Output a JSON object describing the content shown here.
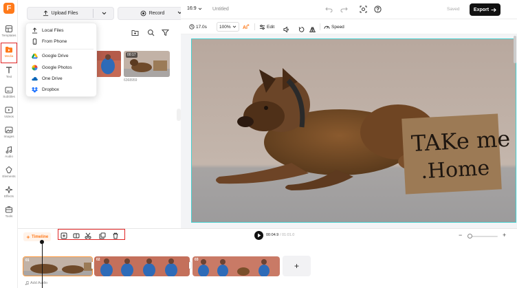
{
  "app": {
    "logo_letter": "F",
    "accent": "#ff7a1a",
    "highlight_red": "#e02424"
  },
  "rail": {
    "items": [
      {
        "label": "Templates",
        "icon": "templates-icon"
      },
      {
        "label": "Media",
        "icon": "media-folder-icon",
        "active": true
      },
      {
        "label": "Text",
        "icon": "text-icon"
      },
      {
        "label": "Subtitles",
        "icon": "subtitles-icon"
      },
      {
        "label": "Videos",
        "icon": "videos-icon"
      },
      {
        "label": "Images",
        "icon": "images-icon"
      },
      {
        "label": "Audio",
        "icon": "audio-icon"
      },
      {
        "label": "Elements",
        "icon": "elements-icon"
      },
      {
        "label": "Effects",
        "icon": "effects-icon"
      },
      {
        "label": "Tools",
        "icon": "tools-icon"
      }
    ]
  },
  "media": {
    "upload_label": "Upload Files",
    "record_label": "Record",
    "dropdown": [
      {
        "label": "Local Files",
        "icon": "upload-icon"
      },
      {
        "label": "From Phone",
        "icon": "phone-icon"
      },
      {
        "label": "Google Drive",
        "icon": "google-drive-icon"
      },
      {
        "label": "Google Photos",
        "icon": "google-photos-icon"
      },
      {
        "label": "One Drive",
        "icon": "onedrive-icon"
      },
      {
        "label": "Dropbox",
        "icon": "dropbox-icon"
      }
    ],
    "thumbs": [
      {
        "duration": "",
        "caption": ""
      },
      {
        "duration": "00:17",
        "caption": "6368959"
      }
    ]
  },
  "topbar": {
    "ratio": "16:9",
    "title": "Untitled",
    "saved": "Saved",
    "export": "Export"
  },
  "edit_tools": {
    "duration": "17.0s",
    "zoom": "100%",
    "edit": "Edit",
    "speed": "Speed"
  },
  "canvas": {
    "sign_line1": "TAKe me",
    "sign_line2": ".Home"
  },
  "timeline": {
    "label": "Timeline",
    "current_time": "00:04.9",
    "total_time": "/ 01:01.0",
    "clips": [
      {
        "number": "01"
      },
      {
        "number": "02"
      },
      {
        "number": "03"
      }
    ],
    "add_clip": "+",
    "add_audio": "Add Audio"
  }
}
